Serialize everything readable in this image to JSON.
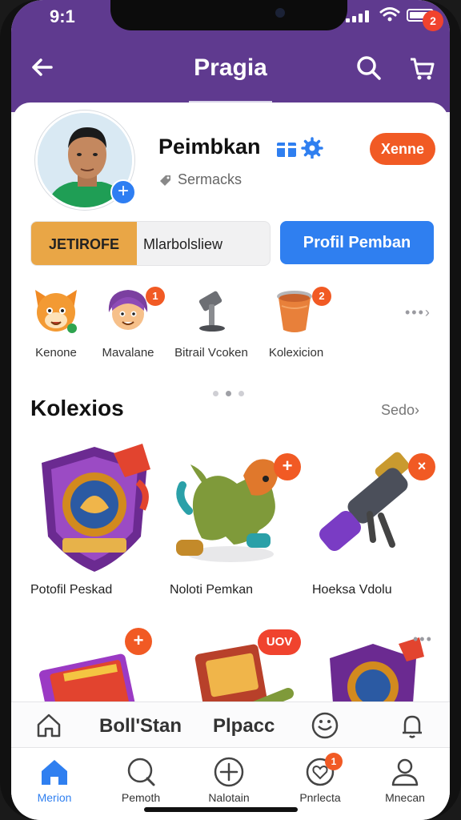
{
  "status_bar": {
    "time": "9:1"
  },
  "header": {
    "title": "Pragia",
    "cart_badge": "2"
  },
  "profile": {
    "name": "Peimbkan",
    "subtitle": "Sermacks",
    "pill": "Xenne",
    "stat_left": "JETIROFE",
    "stat_right": "Mlarbolsliew",
    "profile_button": "Profil Pemban"
  },
  "categories": [
    {
      "label": "Kenone",
      "icon": "fox-mascot-icon",
      "badge": ""
    },
    {
      "label": "Mavalane",
      "icon": "purple-mascot-icon",
      "badge": "1"
    },
    {
      "label": "Bitrail Vcoken",
      "icon": "hammer-icon",
      "badge": ""
    },
    {
      "label": "Kolexicion",
      "icon": "cup-icon",
      "badge": "2"
    }
  ],
  "collection": {
    "title": "Kolexios",
    "see_all": "Sedo",
    "items": [
      {
        "label": "Potofil Peskad",
        "icon": "shield-badge-icon"
      },
      {
        "label": "Noloti Pemkan",
        "icon": "dragon-toy-icon"
      },
      {
        "label": "Hoeksa Vdolu",
        "icon": "cannon-icon"
      }
    ],
    "row2_badge": "UOV"
  },
  "quick_bar": {
    "item1": "Boll'Stan",
    "item2": "Plpacc"
  },
  "tabbar": {
    "tabs": [
      {
        "label": "Merion"
      },
      {
        "label": "Pemoth"
      },
      {
        "label": "Nalotain"
      },
      {
        "label": "Pnrlecta"
      },
      {
        "label": "Mnecan"
      }
    ],
    "tab4_badge": "1"
  },
  "colors": {
    "purple": "#5f3a8f",
    "accent": "#f15a24",
    "blue": "#2f7ff0"
  }
}
